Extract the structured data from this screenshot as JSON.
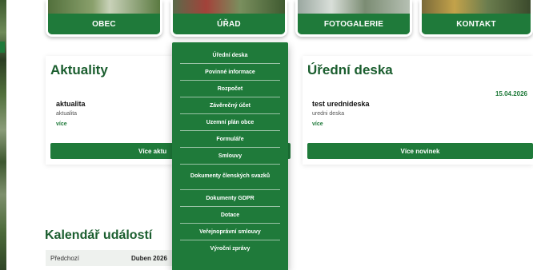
{
  "nav": {
    "tiles": [
      {
        "label": "OBEC"
      },
      {
        "label": "ÚŘAD"
      },
      {
        "label": "FOTOGALERIE"
      },
      {
        "label": "KONTAKT"
      }
    ]
  },
  "dropdown": {
    "items": [
      "Úřední deska",
      "Povinné informace",
      "Rozpočet",
      "Závěrečný účet",
      "Uzemní plán obce",
      "Formuláře",
      "Smlouvy",
      "Dokumenty členských svazků",
      "Dokumenty GDPR",
      "Dotace",
      "Veřejnoprávní smlouvy",
      "Výroční zprávy"
    ]
  },
  "aktuality": {
    "title": "Aktuality",
    "item_title": "aktualita",
    "item_sub": "aktualita",
    "item_more": "více",
    "button": "Více aktu"
  },
  "uredni_deska": {
    "title": "Úřední deska",
    "date": "15.04.2026",
    "item_title": "test urednideska",
    "item_sub": "uredni deska",
    "item_more": "více",
    "button": "Více novinek"
  },
  "kalendar": {
    "title": "Kalendář událostí",
    "prev": "Předchozí",
    "month": "Duben 2026"
  },
  "colors": {
    "brand_green": "#1f7a3a",
    "title_green": "#1b5e2f"
  }
}
